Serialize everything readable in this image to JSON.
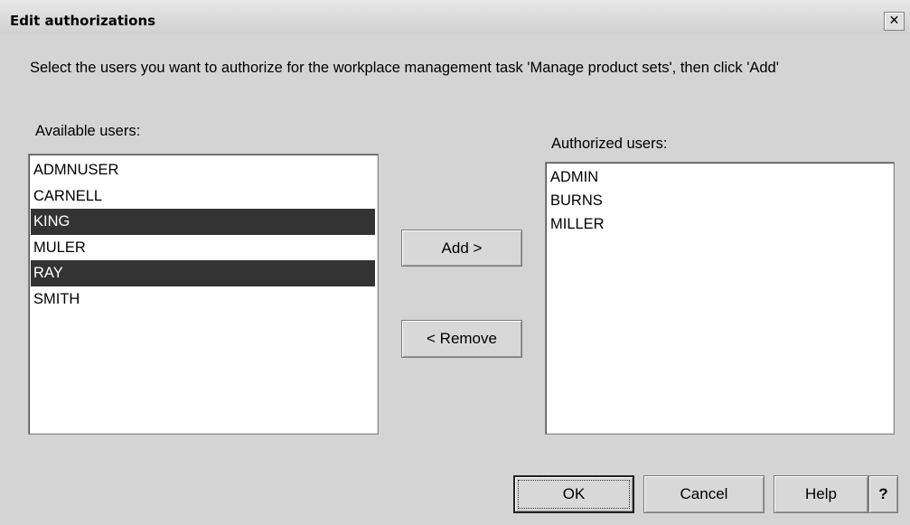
{
  "dialog": {
    "title": "Edit authorizations",
    "close_glyph": "✕"
  },
  "instruction": "Select the users you want to authorize for the workplace management task 'Manage product sets', then click 'Add'",
  "available": {
    "label": "Available users:",
    "items": [
      {
        "name": "ADMNUSER",
        "selected": false
      },
      {
        "name": "CARNELL",
        "selected": false
      },
      {
        "name": "KING",
        "selected": true
      },
      {
        "name": "MULER",
        "selected": false
      },
      {
        "name": "RAY",
        "selected": true
      },
      {
        "name": "SMITH",
        "selected": false
      }
    ]
  },
  "authorized": {
    "label": "Authorized users:",
    "items": [
      {
        "name": "ADMIN",
        "selected": false
      },
      {
        "name": "BURNS",
        "selected": false
      },
      {
        "name": "MILLER",
        "selected": false
      }
    ]
  },
  "buttons": {
    "add": "Add >",
    "remove": "< Remove",
    "ok": "OK",
    "cancel": "Cancel",
    "help": "Help",
    "question": "?"
  },
  "colors": {
    "selection_bg": "#333333",
    "dialog_bg": "#d4d4d4"
  }
}
